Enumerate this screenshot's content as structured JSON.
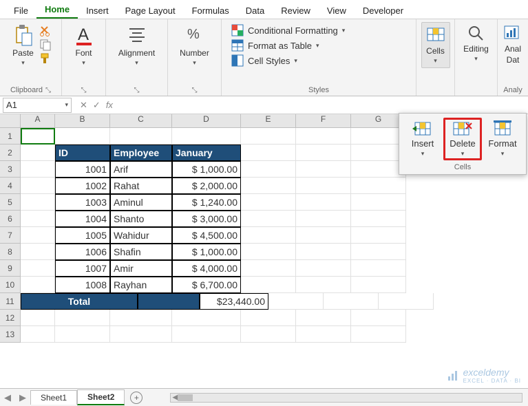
{
  "tabs": [
    "File",
    "Home",
    "Insert",
    "Page Layout",
    "Formulas",
    "Data",
    "Review",
    "View",
    "Developer"
  ],
  "active_tab": "Home",
  "ribbon": {
    "clipboard": {
      "paste": "Paste",
      "label": "Clipboard"
    },
    "font": {
      "btn": "Font",
      "label": "Font"
    },
    "alignment": {
      "btn": "Alignment",
      "label": "Alignment"
    },
    "number": {
      "btn": "Number",
      "label": "Number"
    },
    "styles": {
      "cond": "Conditional Formatting",
      "table": "Format as Table",
      "cell": "Cell Styles",
      "label": "Styles"
    },
    "cells": {
      "btn": "Cells",
      "label": "Cells"
    },
    "editing": {
      "btn": "Editing",
      "label": "Editing"
    },
    "analysis": {
      "btn": "Analyze Data",
      "label": "Analysis",
      "short": "Anal",
      "short2": "Dat",
      "short_label": "Analy"
    }
  },
  "namebox": "A1",
  "columns": [
    "A",
    "B",
    "C",
    "D",
    "E",
    "F",
    "G"
  ],
  "rows": [
    1,
    2,
    3,
    4,
    5,
    6,
    7,
    8,
    9,
    10,
    11,
    12,
    13
  ],
  "table": {
    "headers": [
      "ID",
      "Employee",
      "January"
    ],
    "data": [
      {
        "id": "1001",
        "emp": "Arif",
        "jan": "$  1,000.00"
      },
      {
        "id": "1002",
        "emp": "Rahat",
        "jan": "$  2,000.00"
      },
      {
        "id": "1003",
        "emp": "Aminul",
        "jan": "$  1,240.00"
      },
      {
        "id": "1004",
        "emp": "Shanto",
        "jan": "$  3,000.00"
      },
      {
        "id": "1005",
        "emp": "Wahidur",
        "jan": "$  4,500.00"
      },
      {
        "id": "1006",
        "emp": "Shafin",
        "jan": "$  1,000.00"
      },
      {
        "id": "1007",
        "emp": "Amir",
        "jan": "$  4,000.00"
      },
      {
        "id": "1008",
        "emp": "Rayhan",
        "jan": "$  6,700.00"
      }
    ],
    "total_label": "Total",
    "total_value": "$23,440.00"
  },
  "popup": {
    "insert": "Insert",
    "delete": "Delete",
    "format": "Format",
    "label": "Cells"
  },
  "sheets": [
    "Sheet1",
    "Sheet2"
  ],
  "active_sheet": "Sheet2",
  "watermark": {
    "brand": "exceldemy",
    "tag": "EXCEL · DATA · BI"
  }
}
